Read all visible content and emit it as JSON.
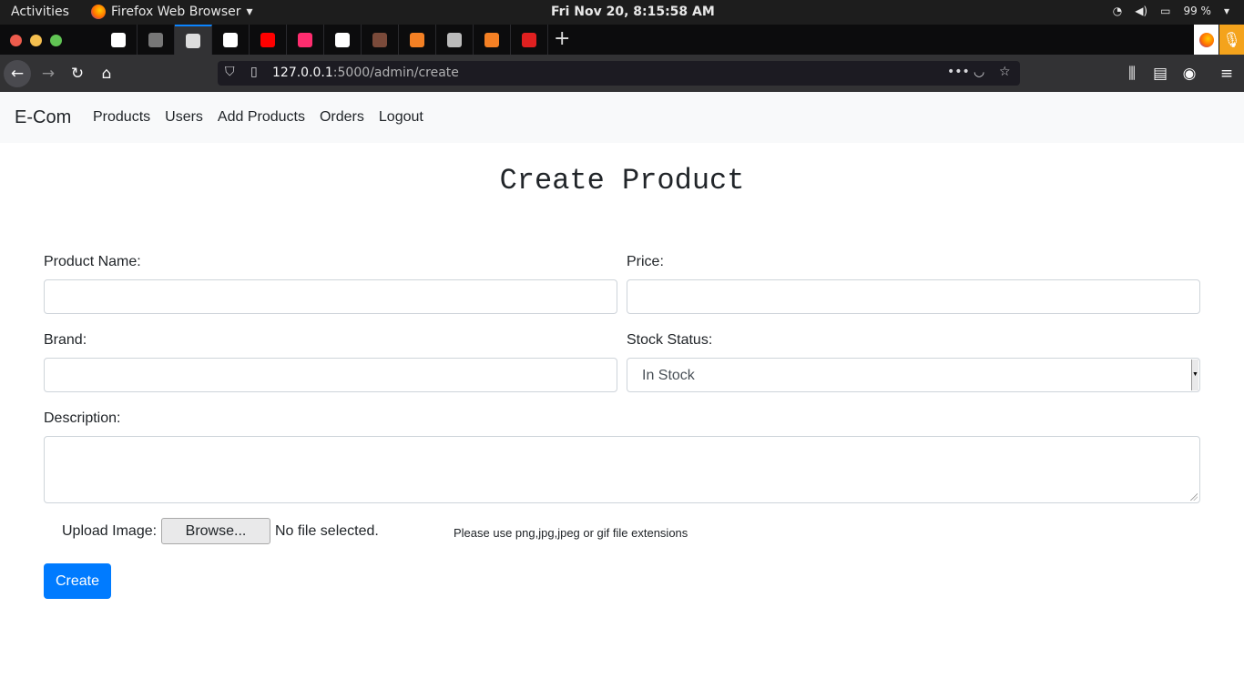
{
  "os": {
    "activities": "Activities",
    "app_menu": "Firefox Web Browser",
    "clock": "Fri Nov 20,  8:15:58 AM",
    "battery": "99 %"
  },
  "browser": {
    "url_host": "127.0.0.1",
    "url_rest": ":5000/admin/create",
    "tabs": [
      {
        "icon": "github-icon",
        "color": "#ffffff"
      },
      {
        "icon": "site-icon",
        "color": "#777777"
      },
      {
        "icon": "cart-icon",
        "color": "#dddddd"
      },
      {
        "icon": "news-icon",
        "color": "#ffffff"
      },
      {
        "icon": "youtube-icon",
        "color": "#ff0000"
      },
      {
        "icon": "music-icon",
        "color": "#ff2d6f"
      },
      {
        "icon": "medium-icon",
        "color": "#ffffff"
      },
      {
        "icon": "avatar-icon",
        "color": "#7a4a3a"
      },
      {
        "icon": "stackoverflow-icon",
        "color": "#f48024"
      },
      {
        "icon": "phone-icon",
        "color": "#bbbbbb"
      },
      {
        "icon": "stackoverflow-icon",
        "color": "#f48024"
      },
      {
        "icon": "microphone-icon",
        "color": "#e02020"
      }
    ]
  },
  "site": {
    "brand": "E-Com",
    "nav": [
      "Products",
      "Users",
      "Add Products",
      "Orders",
      "Logout"
    ]
  },
  "form": {
    "title": "Create Product",
    "product_name_label": "Product Name:",
    "price_label": "Price:",
    "brand_label": "Brand:",
    "stock_label": "Stock Status:",
    "stock_value": "In Stock",
    "description_label": "Description:",
    "upload_label": "Upload Image:",
    "browse_label": "Browse...",
    "no_file": "No file selected.",
    "hint": "Please use png,jpg,jpeg or gif file extensions",
    "submit_label": "Create"
  },
  "colors": {
    "primary": "#007bff",
    "navbar_bg": "#f8f9fa"
  }
}
